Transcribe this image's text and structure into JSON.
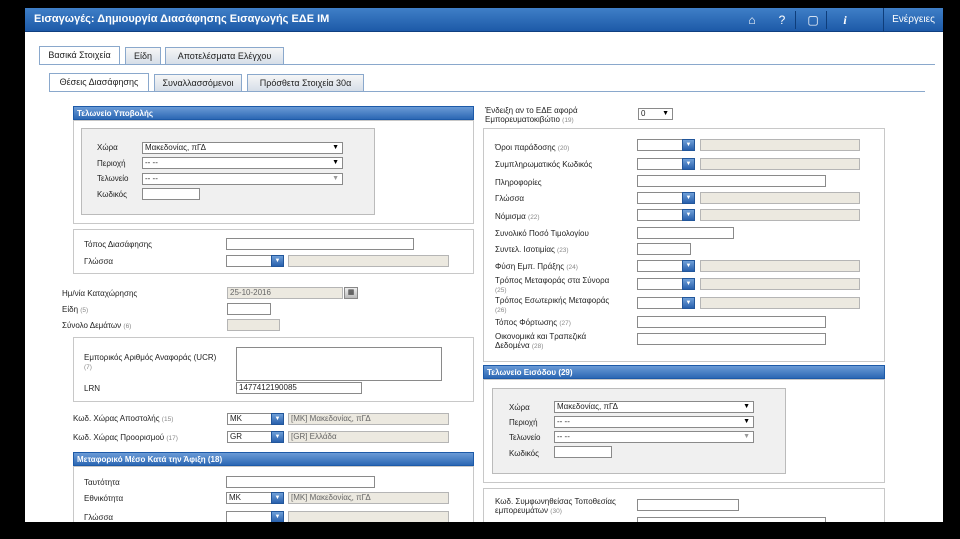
{
  "header": {
    "title": "Εισαγωγές: Δημιουργία Διασάφησης Εισαγωγής ΕΔΕ ΙΜ",
    "actions_label": "Ενέργειες",
    "icons": [
      "home-icon",
      "help-icon",
      "window-icon",
      "info-icon"
    ]
  },
  "tabs_main": [
    "Βασικά Στοιχεία",
    "Είδη",
    "Αποτελέσματα Ελέγχου"
  ],
  "tabs_sub": [
    "Θέσεις Διασάφησης",
    "Συναλλασσόμενοι",
    "Πρόσθετα Στοιχεία 30α"
  ],
  "left": {
    "submission_office": {
      "header": "Τελωνείο Υποβολής",
      "country_label": "Χώρα",
      "country_value": "Μακεδονίας, πΓΔ",
      "region_label": "Περιοχή",
      "region_value": "-- --",
      "office_label": "Τελωνείο",
      "office_value": "-- --",
      "code_label": "Κωδικός"
    },
    "place_label": "Τόπος Διασάφησης",
    "language_label": "Γλώσσα",
    "date_label": "Ημ/νία Καταχώρησης",
    "date_value": "25-10-2016",
    "items_label": "Είδη",
    "items_num": "(5)",
    "packages_label": "Σύνολο Δεμάτων",
    "packages_num": "(6)",
    "ucr_label": "Εμπορικός Αριθμός Αναφοράς (UCR)",
    "ucr_num": "(7)",
    "lrn_label": "LRN",
    "lrn_value": "1477412190085",
    "dispatch_label": "Κωδ. Χώρας Αποστολής",
    "dispatch_num": "(15)",
    "dispatch_code": "MK",
    "dispatch_name": "[MK] Μακεδονίας, πΓΔ",
    "destination_label": "Κωδ. Χώρας Προορισμού",
    "destination_num": "(17)",
    "destination_code": "GR",
    "destination_name": "[GR] Ελλάδα",
    "transport": {
      "header": "Μεταφορικό Μέσο Κατά την Άφιξη (18)",
      "identity_label": "Ταυτότητα",
      "nationality_label": "Εθνικότητα",
      "nationality_code": "MK",
      "nationality_name": "[MK] Μακεδονίας, πΓΔ",
      "language_label": "Γλώσσα"
    }
  },
  "right": {
    "container_label_1": "Ένδειξη αν το ΕΔΕ αφορά",
    "container_label_2": "Εμπορευματοκιβώτιο",
    "container_num": "(19)",
    "container_value": "0",
    "delivery_label": "Όροι παράδοσης",
    "delivery_num": "(20)",
    "supplementary_label": "Συμπληρωματικός Κωδικός",
    "information_label": "Πληροφορίες",
    "language_label": "Γλώσσα",
    "currency_label": "Νόμισμα",
    "currency_num": "(22)",
    "total_invoice_label": "Συνολικό Ποσό Τιμολογίου",
    "exchange_label": "Συντελ. Ισοτιμίας",
    "exchange_num": "(23)",
    "transaction_label": "Φύση Εμπ. Πράξης",
    "transaction_num": "(24)",
    "border_mode_label": "Τρόπος Μεταφοράς στα Σύνορα",
    "border_mode_num": "(25)",
    "inland_mode_label": "Τρόπος Εσωτερικής Μεταφοράς",
    "inland_mode_num": "(26)",
    "loading_label": "Τόπος Φόρτωσης",
    "loading_num": "(27)",
    "financial_label_1": "Οικονομικά και Τραπεζικά",
    "financial_label_2": "Δεδομένα",
    "financial_num": "(28)",
    "entry_office": {
      "header": "Τελωνείο Εισόδου (29)",
      "country_label": "Χώρα",
      "country_value": "Μακεδονίας, πΓΔ",
      "region_label": "Περιοχή",
      "region_value": "-- --",
      "office_label": "Τελωνείο",
      "office_value": "-- --",
      "code_label": "Κωδικός"
    },
    "agreed_location_label_1": "Κωδ. Συμφωνηθείσας Τοποθεσίας",
    "agreed_location_label_2": "εμπορευμάτων",
    "agreed_location_num": "(30)"
  },
  "colors": {
    "header_blue": "#2c68b4",
    "title_bar": "#1d5aa8",
    "disabled_field": "#ece9e0"
  }
}
